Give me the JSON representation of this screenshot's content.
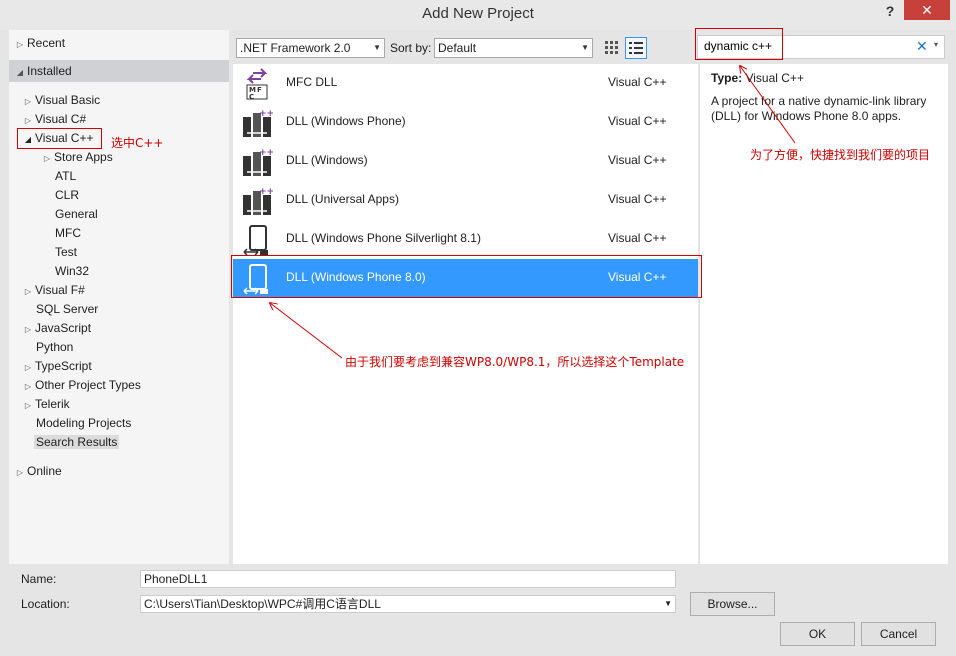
{
  "dialog": {
    "title": "Add New Project",
    "help_label": "?",
    "close_label": "✕"
  },
  "tree": {
    "recent": "Recent",
    "installed": "Installed",
    "items": [
      {
        "label": "Visual Basic",
        "expander": "▷"
      },
      {
        "label": "Visual C#",
        "expander": "▷"
      },
      {
        "label": "Visual C++",
        "expander": "◢"
      },
      {
        "label": "Store Apps",
        "expander": "▷"
      },
      {
        "label": "ATL",
        "expander": ""
      },
      {
        "label": "CLR",
        "expander": ""
      },
      {
        "label": "General",
        "expander": ""
      },
      {
        "label": "MFC",
        "expander": ""
      },
      {
        "label": "Test",
        "expander": ""
      },
      {
        "label": "Win32",
        "expander": ""
      },
      {
        "label": "Visual F#",
        "expander": "▷"
      },
      {
        "label": "SQL Server",
        "expander": ""
      },
      {
        "label": "JavaScript",
        "expander": "▷"
      },
      {
        "label": "Python",
        "expander": ""
      },
      {
        "label": "TypeScript",
        "expander": "▷"
      },
      {
        "label": "Other Project Types",
        "expander": "▷"
      },
      {
        "label": "Telerik",
        "expander": "▷"
      },
      {
        "label": "Modeling Projects",
        "expander": ""
      },
      {
        "label": "Search Results",
        "expander": ""
      }
    ],
    "online": "Online"
  },
  "toolbar": {
    "framework": ".NET Framework 2.0",
    "sort_label": "Sort by:",
    "sort_value": "Default"
  },
  "search": {
    "value": "dynamic c++",
    "clear_icon": "✕",
    "dropdown_icon": "▾"
  },
  "templates": [
    {
      "name": "MFC DLL",
      "lang": "Visual C++",
      "icon": "mfc-dll-icon"
    },
    {
      "name": "DLL (Windows Phone)",
      "lang": "Visual C++",
      "icon": "dll-cpp-icon"
    },
    {
      "name": "DLL (Windows)",
      "lang": "Visual C++",
      "icon": "dll-cpp-icon"
    },
    {
      "name": "DLL (Universal Apps)",
      "lang": "Visual C++",
      "icon": "dll-cpp-icon"
    },
    {
      "name": "DLL (Windows Phone Silverlight 8.1)",
      "lang": "Visual C++",
      "icon": "phone-dll-icon"
    },
    {
      "name": "DLL (Windows Phone 8.0)",
      "lang": "Visual C++",
      "icon": "phone-dll-icon",
      "selected": true
    }
  ],
  "details": {
    "type_label": "Type:",
    "type_value": "Visual C++",
    "description": "A project for a native dynamic-link library (DLL) for Windows Phone 8.0 apps."
  },
  "form": {
    "name_label": "Name:",
    "name_value": "PhoneDLL1",
    "location_label": "Location:",
    "location_value": "C:\\Users\\Tian\\Desktop\\WPC#调用C语言DLL",
    "browse_label": "Browse...",
    "ok_label": "OK",
    "cancel_label": "Cancel"
  },
  "annotations": {
    "select_cpp": "选中C++",
    "search_note": "为了方便，快捷找到我们要的项目",
    "template_note": "由于我们要考虑到兼容WP8.0/WP8.1，所以选择这个Template",
    "color": "#d00000"
  },
  "colors": {
    "selection": "#3399ff",
    "close": "#c7413a",
    "installed_bg": "#cfd1d4"
  }
}
